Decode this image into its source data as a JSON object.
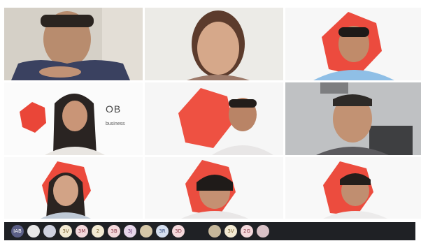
{
  "tiles": [
    {
      "id": "p1"
    },
    {
      "id": "p2"
    },
    {
      "id": "p3"
    },
    {
      "id": "p4",
      "logo_fragment": "OB",
      "tagline_fragment": "business"
    },
    {
      "id": "p5"
    },
    {
      "id": "p6"
    },
    {
      "id": "p7"
    },
    {
      "id": "p8"
    },
    {
      "id": "p9"
    }
  ],
  "bottom_bar": {
    "chips": [
      {
        "label": "IAB",
        "color": "#5b5f86",
        "text_color": "#ffffff"
      },
      {
        "label": "",
        "color": "#e8e8e8",
        "text_color": "#333"
      },
      {
        "label": "",
        "color": "#cfd2e0",
        "text_color": "#333"
      },
      {
        "label": "3V",
        "color": "#f3ead3",
        "text_color": "#7a6330"
      },
      {
        "label": "3M",
        "color": "#f4d9dc",
        "text_color": "#8a3c4a"
      },
      {
        "label": "2",
        "color": "#f3ead3",
        "text_color": "#7a6330"
      },
      {
        "label": "3B",
        "color": "#f4d9dc",
        "text_color": "#8a3c4a"
      },
      {
        "label": "3J",
        "color": "#e6d6ea",
        "text_color": "#6b3c7a"
      },
      {
        "label": "",
        "color": "#d6c7a8",
        "text_color": "#333"
      },
      {
        "label": "3R",
        "color": "#d5dff0",
        "text_color": "#3a5080"
      },
      {
        "label": "3D",
        "color": "#f4d9dc",
        "text_color": "#8a3c4a"
      },
      {
        "label": "",
        "color": "#c7b89b",
        "text_color": "#333"
      },
      {
        "label": "3V",
        "color": "#f3ead3",
        "text_color": "#7a6330"
      },
      {
        "label": "2G",
        "color": "#f4d9dc",
        "text_color": "#8a3c4a"
      },
      {
        "label": "",
        "color": "#d9c2c7",
        "text_color": "#333"
      }
    ]
  }
}
